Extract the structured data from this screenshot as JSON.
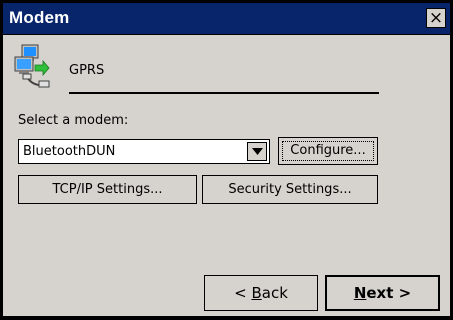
{
  "window": {
    "title": "Modem",
    "close_label": "×"
  },
  "connection": {
    "icon": "network-computer-icon",
    "name": "GPRS"
  },
  "modem_select": {
    "label": "Select a modem:",
    "value": "BluetoothDUN",
    "arrow_icon": "chevron-down-icon"
  },
  "buttons": {
    "configure": "Configure...",
    "tcpip": "TCP/IP Settings...",
    "security": "Security Settings...",
    "back_prefix": "< ",
    "back_mnemonic": "B",
    "back_rest": "ack",
    "next_mnemonic": "N",
    "next_rest": "ext >"
  },
  "colors": {
    "titlebar": "#08246b",
    "window_bg": "#d6d3ce"
  }
}
